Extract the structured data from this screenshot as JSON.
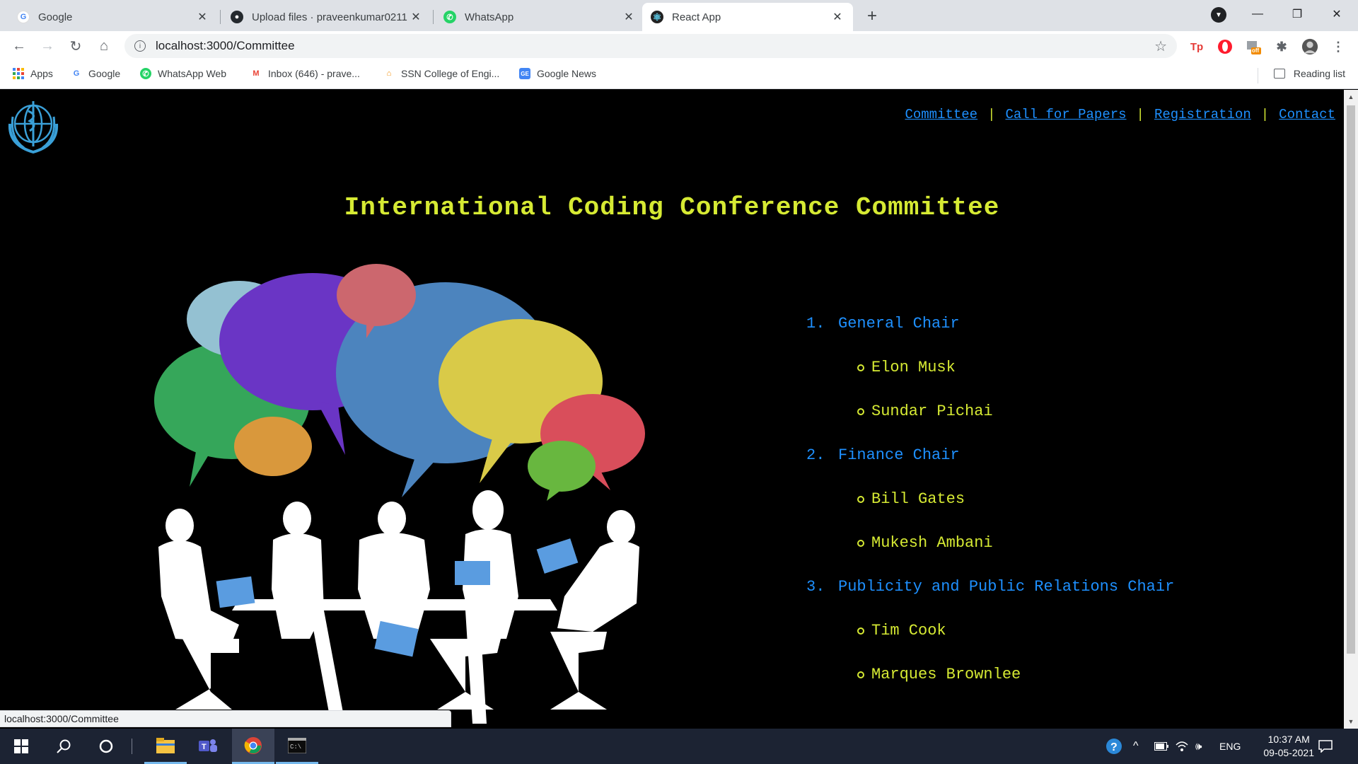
{
  "browser": {
    "tabs": [
      {
        "title": "Google",
        "icon": "google-icon"
      },
      {
        "title": "Upload files · praveenkumar0211",
        "icon": "github-icon"
      },
      {
        "title": "WhatsApp",
        "icon": "whatsapp-icon"
      },
      {
        "title": "React App",
        "icon": "react-icon",
        "active": true
      }
    ],
    "url": "localhost:3000/Committee",
    "bookmarks": [
      {
        "label": "Apps",
        "icon": "apps-grid-icon"
      },
      {
        "label": "Google",
        "icon": "google-icon"
      },
      {
        "label": "WhatsApp Web",
        "icon": "whatsapp-icon"
      },
      {
        "label": "Inbox (646) - prave...",
        "icon": "gmail-icon"
      },
      {
        "label": "SSN College of Engi...",
        "icon": "ssn-icon"
      },
      {
        "label": "Google News",
        "icon": "google-news-icon"
      }
    ],
    "reading_list": "Reading list",
    "extension_badge": "off",
    "status_url": "localhost:3000/Committee"
  },
  "page": {
    "nav": [
      "Committee",
      "Call for Papers",
      "Registration",
      "Contact"
    ],
    "nav_separator": "|",
    "heading": "International Coding Conference Committee",
    "committee": [
      {
        "number": "1.",
        "title": "General Chair",
        "members": [
          "Elon Musk",
          "Sundar Pichai"
        ]
      },
      {
        "number": "2.",
        "title": "Finance Chair",
        "members": [
          "Bill Gates",
          "Mukesh Ambani"
        ]
      },
      {
        "number": "3.",
        "title": "Publicity and Public Relations Chair",
        "members": [
          "Tim Cook",
          "Marques Brownlee"
        ]
      }
    ],
    "colors": {
      "nav_link": "#1e90ff",
      "heading": "#d6ea33",
      "background": "#000000"
    }
  },
  "taskbar": {
    "language": "ENG",
    "time": "10:37 AM",
    "date": "09-05-2021"
  }
}
